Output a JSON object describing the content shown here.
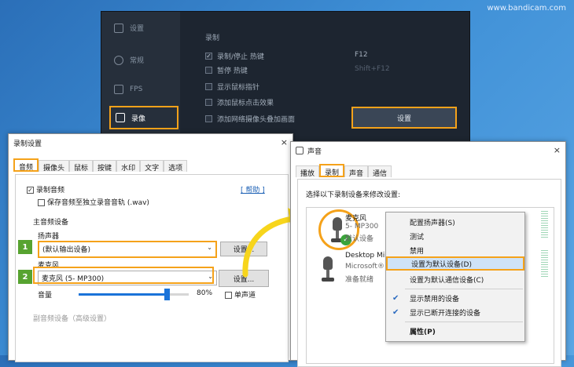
{
  "watermark": "www.bandicam.com",
  "bandicam": {
    "sidebar": [
      {
        "label": "设置",
        "icon": "home-icon"
      },
      {
        "label": "常规",
        "icon": "gear-icon"
      },
      {
        "label": "FPS",
        "icon": "fps-icon"
      },
      {
        "label": "录像",
        "icon": "record-icon"
      }
    ],
    "section_title": "录制",
    "options": [
      {
        "label": "录制/停止 热键",
        "checked": true,
        "hotkey": "F12"
      },
      {
        "label": "暂停 热键",
        "checked": false,
        "hotkey": "Shift+F12"
      },
      {
        "label": "显示鼠标指针",
        "checked": false
      },
      {
        "label": "添加鼠标点击效果",
        "checked": false
      },
      {
        "label": "添加网络摄像头叠加画面",
        "checked": false
      }
    ],
    "settings_button": "设置"
  },
  "rec_dialog": {
    "title": "录制设置",
    "close": "×",
    "tabs": [
      "音频",
      "摄像头",
      "鼠标",
      "按键",
      "水印",
      "文字",
      "选项"
    ],
    "record_audio": "录制音频",
    "save_separate": "保存音频至独立录音音轨 (.wav)",
    "help": "[ 帮助 ]",
    "main_device": "主音频设备",
    "speaker_label": "扬声器",
    "speaker_value": "(默认输出设备)",
    "mic_label": "麦克风",
    "mic_value": "麦克风 (5- MP300)",
    "settings_btn": "设置...",
    "volume_label": "音量",
    "volume_value": "80%",
    "volume_level": 0.8,
    "mono_label": "单声道",
    "sub_device": "副音频设备（高级设置）",
    "step1": "1",
    "step2": "2"
  },
  "sound_dialog": {
    "title": "声音",
    "close": "×",
    "tabs": [
      "播放",
      "录制",
      "声音",
      "通信"
    ],
    "instruction": "选择以下录制设备来修改设置:",
    "devices": [
      {
        "name": "麦克风",
        "desc": "5- MP300",
        "status": "默认设备"
      },
      {
        "name": "Desktop Mi",
        "desc": "Microsoft®",
        "status": "准备就绪"
      }
    ]
  },
  "context_menu": [
    {
      "label": "配置扬声器(S)"
    },
    {
      "label": "测试"
    },
    {
      "label": "禁用"
    },
    {
      "label": "设置为默认设备(D)",
      "selected": true
    },
    {
      "label": "设置为默认通信设备(C)"
    },
    {
      "label": "显示禁用的设备",
      "checked": true
    },
    {
      "label": "显示已断开连接的设备",
      "checked": true
    },
    {
      "label": "属性(P)",
      "bold": true
    }
  ],
  "colors": {
    "highlight": "#f5a21a",
    "step_badge": "#57a330",
    "arrow": "#f7d51c"
  }
}
